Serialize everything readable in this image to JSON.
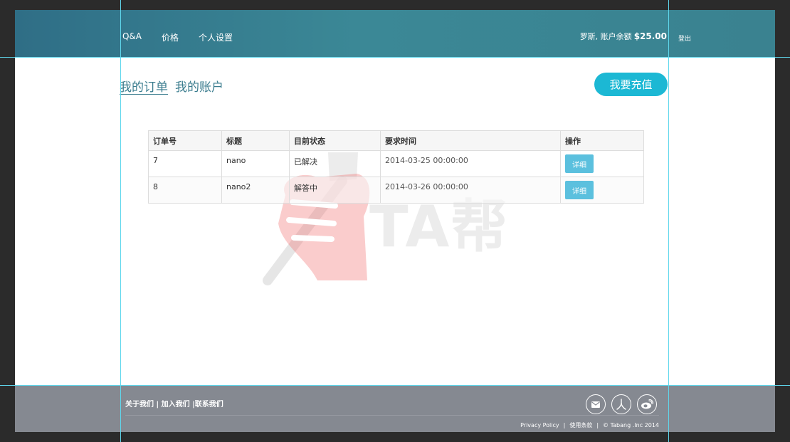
{
  "nav": {
    "items": [
      {
        "label": "Q&A"
      },
      {
        "label": "价格"
      },
      {
        "label": "个人设置"
      }
    ]
  },
  "user": {
    "name_text": "罗斯, 账户余额",
    "balance": "$25.00",
    "logout_label": "登出"
  },
  "tabs": [
    {
      "label": "我的订单",
      "active": true
    },
    {
      "label": "我的账户",
      "active": false
    }
  ],
  "recharge_label": "我要充值",
  "orders": {
    "headers": [
      "订单号",
      "标题",
      "目前状态",
      "要求时间",
      "操作"
    ],
    "rows": [
      {
        "id": "7",
        "title": "nano",
        "status": "已解决",
        "time": "2014-03-25 00:00:00",
        "action": "详细"
      },
      {
        "id": "8",
        "title": "nano2",
        "status": "解答中",
        "time": "2014-03-26 00:00:00",
        "action": "详细"
      }
    ]
  },
  "watermark": {
    "text": "TA帮"
  },
  "footer": {
    "links": [
      "关于我们",
      "加入我们",
      "联系我们"
    ],
    "social_icons": [
      "mail-icon",
      "renren-icon",
      "weibo-icon"
    ],
    "legal": {
      "privacy": "Privacy Policy",
      "terms": "使用条款",
      "copyright": "© Tabang .Inc 2014"
    }
  },
  "colors": {
    "header": "#3a8290",
    "accent": "#1cb8d4",
    "link": "#3a7c8e",
    "detail_button": "#5bc0de",
    "footer": "#858991"
  }
}
